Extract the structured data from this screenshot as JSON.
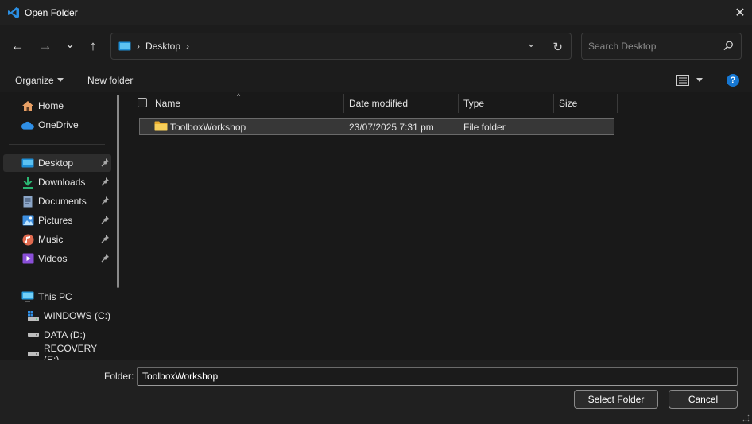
{
  "window": {
    "title": "Open Folder",
    "close_glyph": "✕"
  },
  "navigation": {
    "back_glyph": "←",
    "forward_glyph": "→",
    "recent_glyph": "⌄",
    "up_glyph": "↑",
    "breadcrumb": [
      "Desktop"
    ],
    "separator_glyph": "›",
    "dropdown_glyph": "⌄",
    "refresh_glyph": "↻"
  },
  "search": {
    "placeholder": "Search Desktop"
  },
  "toolbar": {
    "organize_label": "Organize",
    "new_folder_label": "New folder",
    "help_glyph": "?"
  },
  "sidebar": {
    "quick": [
      {
        "label": "Home",
        "icon": "home-icon"
      },
      {
        "label": "OneDrive",
        "icon": "cloud-icon"
      }
    ],
    "pinned": [
      {
        "label": "Desktop",
        "icon": "desktop-icon",
        "selected": true
      },
      {
        "label": "Downloads",
        "icon": "download-icon"
      },
      {
        "label": "Documents",
        "icon": "document-icon"
      },
      {
        "label": "Pictures",
        "icon": "picture-icon"
      },
      {
        "label": "Music",
        "icon": "music-icon"
      },
      {
        "label": "Videos",
        "icon": "video-icon"
      }
    ],
    "this_pc": {
      "label": "This PC",
      "icon": "computer-icon"
    },
    "drives": [
      {
        "label": "WINDOWS (C:)",
        "icon": "system-drive-icon"
      },
      {
        "label": "DATA (D:)",
        "icon": "drive-icon"
      },
      {
        "label": "RECOVERY (E:)",
        "icon": "drive-icon"
      }
    ]
  },
  "file_list": {
    "sort_glyph": "^",
    "columns": [
      "Name",
      "Date modified",
      "Type",
      "Size"
    ],
    "rows": [
      {
        "name": "ToolboxWorkshop",
        "date_modified": "23/07/2025 7:31 pm",
        "type": "File folder",
        "size": ""
      }
    ]
  },
  "footer": {
    "folder_label": "Folder:",
    "folder_value": "ToolboxWorkshop",
    "select_label": "Select Folder",
    "cancel_label": "Cancel"
  },
  "colors": {
    "accent": "#1677d2",
    "folder": "#f2c14e",
    "background": "#191919"
  }
}
